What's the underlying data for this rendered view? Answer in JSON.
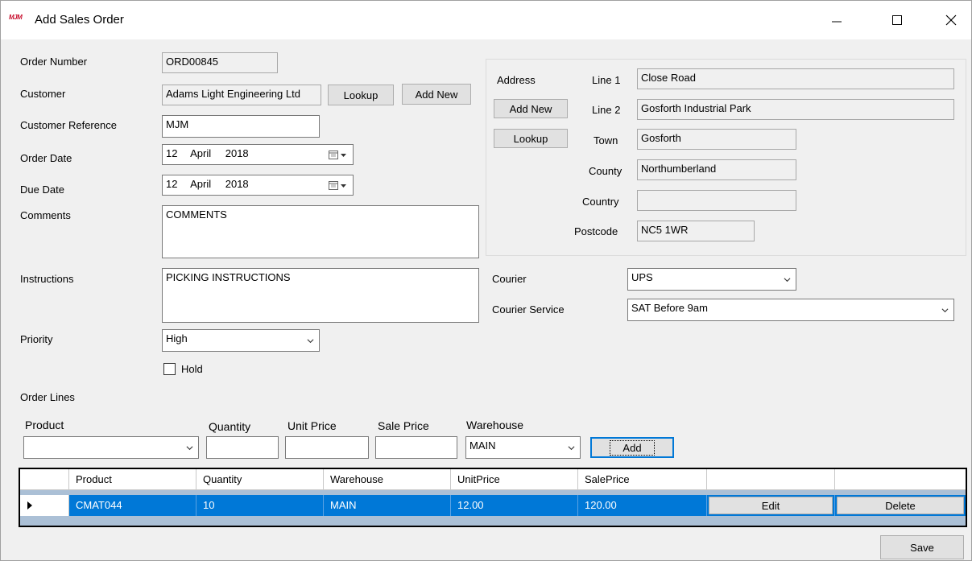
{
  "window": {
    "title": "Add Sales Order",
    "logo": "MJM",
    "controls": [
      "minimize-icon",
      "maximize-icon",
      "close-icon"
    ]
  },
  "form": {
    "order_number": {
      "label": "Order Number",
      "value": "ORD00845"
    },
    "customer": {
      "label": "Customer",
      "value": "Adams Light Engineering Ltd",
      "lookup": "Lookup",
      "add_new": "Add New"
    },
    "customer_reference": {
      "label": "Customer Reference",
      "value": "MJM"
    },
    "order_date": {
      "label": "Order Date",
      "day": "12",
      "month": "April",
      "year": "2018"
    },
    "due_date": {
      "label": "Due Date",
      "day": "12",
      "month": "April",
      "year": "2018"
    },
    "comments": {
      "label": "Comments",
      "value": "COMMENTS"
    },
    "instructions": {
      "label": "Instructions",
      "value": "PICKING INSTRUCTIONS"
    },
    "priority": {
      "label": "Priority",
      "value": "High"
    },
    "hold": {
      "label": "Hold",
      "checked": false
    }
  },
  "address": {
    "label": "Address",
    "add_new": "Add New",
    "lookup": "Lookup",
    "line1": {
      "label": "Line 1",
      "value": "Close Road"
    },
    "line2": {
      "label": "Line 2",
      "value": "Gosforth Industrial Park"
    },
    "town": {
      "label": "Town",
      "value": "Gosforth"
    },
    "county": {
      "label": "County",
      "value": "Northumberland"
    },
    "country": {
      "label": "Country",
      "value": ""
    },
    "postcode": {
      "label": "Postcode",
      "value": "NC5 1WR"
    }
  },
  "courier": {
    "label": "Courier",
    "value": "UPS",
    "service_label": "Courier Service",
    "service_value": "SAT Before 9am"
  },
  "order_lines": {
    "title": "Order Lines",
    "product_label": "Product",
    "quantity_label": "Quantity",
    "unit_price_label": "Unit Price",
    "sale_price_label": "Sale Price",
    "warehouse_label": "Warehouse",
    "warehouse_value": "MAIN",
    "add_label": "Add",
    "grid": {
      "columns": [
        "Product",
        "Quantity",
        "Warehouse",
        "UnitPrice",
        "SalePrice",
        "",
        ""
      ],
      "rows": [
        {
          "product": "CMAT044",
          "quantity": "10",
          "warehouse": "MAIN",
          "unit_price": "12.00",
          "sale_price": "120.00",
          "edit": "Edit",
          "delete": "Delete"
        }
      ]
    }
  },
  "save_label": "Save",
  "colors": {
    "selection": "#0078d7",
    "accent_red": "#c8102e",
    "window_bg": "#f0f0f0"
  }
}
